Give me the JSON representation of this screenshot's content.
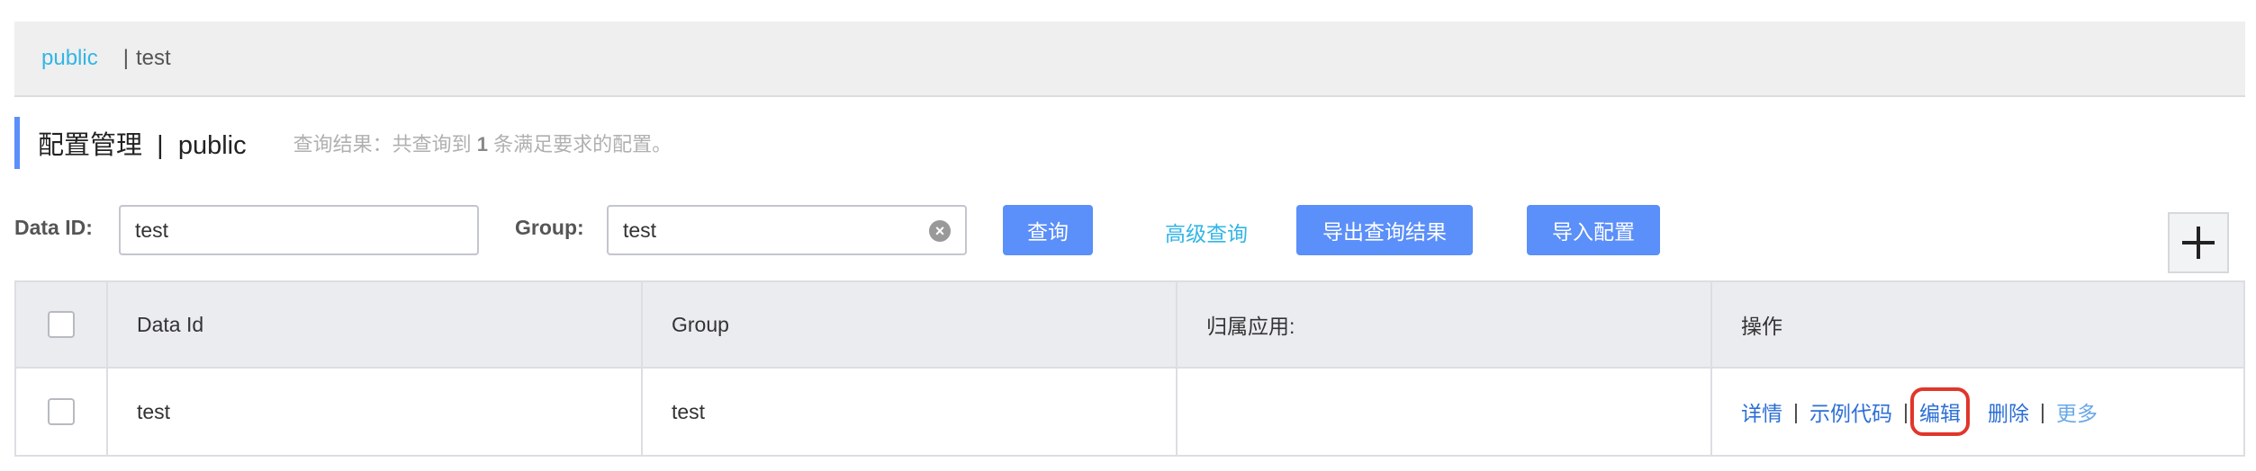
{
  "namespace_bar": {
    "active": "public",
    "separator": "|",
    "other": "test"
  },
  "page": {
    "title": "配置管理",
    "separator": "|",
    "namespace": "public",
    "result_prefix": "查询结果：共查询到",
    "result_count": "1",
    "result_suffix": "条满足要求的配置。"
  },
  "filters": {
    "data_id_label": "Data ID:",
    "data_id_value": "test",
    "group_label": "Group:",
    "group_value": "test",
    "query_button": "查询",
    "advanced_query": "高级查询",
    "export_button": "导出查询结果",
    "import_button": "导入配置"
  },
  "table": {
    "columns": [
      "Data Id",
      "Group",
      "归属应用:",
      "操作"
    ],
    "rows": [
      {
        "data_id": "test",
        "group": "test",
        "app": ""
      }
    ],
    "actions": {
      "detail": "详情",
      "sample_code": "示例代码",
      "edit": "编辑",
      "delete": "删除",
      "more": "更多",
      "sep": "|"
    }
  },
  "colors": {
    "accent": "#5b8ff9",
    "link": "#33b5e5",
    "highlight": "#e0362c"
  },
  "icons": {
    "add": "plus-icon",
    "clear": "clear-icon"
  }
}
